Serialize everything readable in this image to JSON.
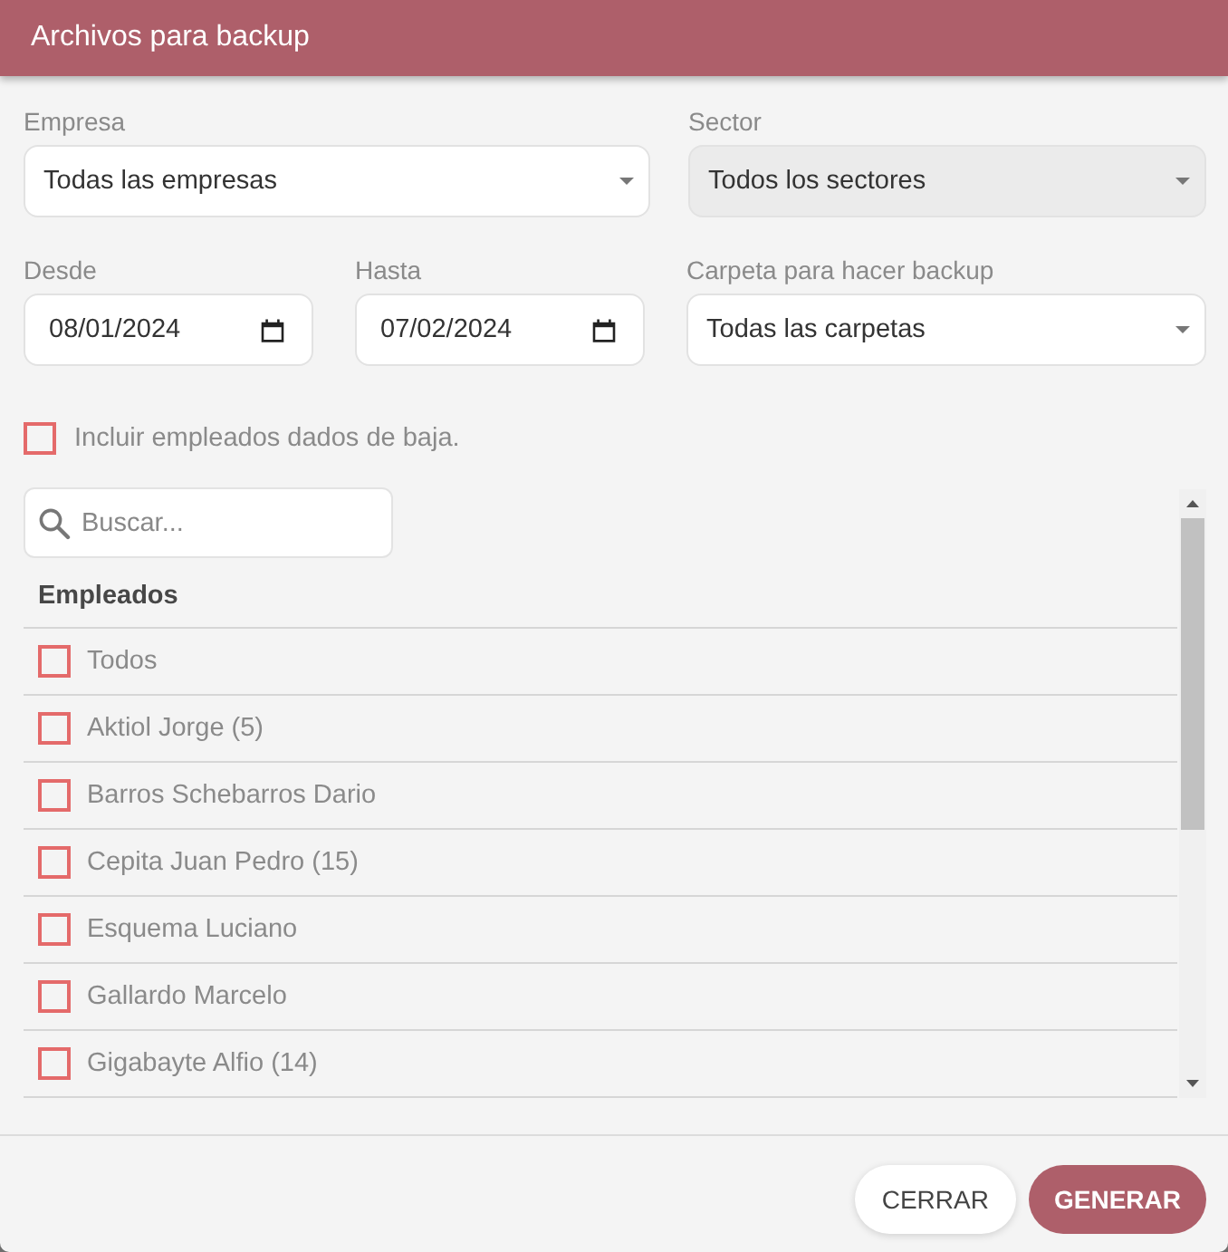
{
  "dialog": {
    "title": "Archivos para backup"
  },
  "filter_rows": [
    [
      {
        "label": "Empresa",
        "kind": "select",
        "value": "Todas las empresas",
        "disabled": false
      },
      {
        "label": "Sector",
        "kind": "select",
        "value": "Todos los sectores",
        "disabled": true
      }
    ],
    [
      {
        "label": "Desde",
        "kind": "date",
        "value": "08/01/2024",
        "disabled": false
      },
      {
        "label": "Hasta",
        "kind": "date",
        "value": "07/02/2024",
        "disabled": false
      },
      {
        "label": "Carpeta para hacer backup",
        "kind": "select",
        "value": "Todas las carpetas",
        "disabled": false
      }
    ]
  ],
  "include_inactive": {
    "label": "Incluir empleados dados de baja.",
    "checked": false
  },
  "search": {
    "placeholder": "Buscar..."
  },
  "employees": {
    "heading": "Empleados",
    "items": [
      {
        "name": "Todos",
        "checked": false
      },
      {
        "name": "Aktiol Jorge (5)",
        "checked": false
      },
      {
        "name": "Barros Schebarros Dario",
        "checked": false
      },
      {
        "name": "Cepita Juan Pedro (15)",
        "checked": false
      },
      {
        "name": "Esquema Luciano",
        "checked": false
      },
      {
        "name": "Gallardo Marcelo",
        "checked": false
      },
      {
        "name": "Gigabayte Alfio (14)",
        "checked": false
      }
    ]
  },
  "buttons": [
    {
      "label": "CERRAR",
      "kind": "secondary"
    },
    {
      "label": "GENERAR",
      "kind": "primary"
    }
  ]
}
